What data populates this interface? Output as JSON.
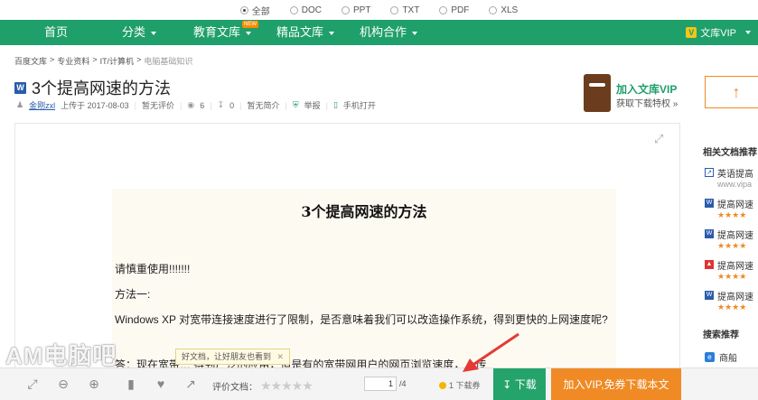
{
  "filters": [
    "全部",
    "DOC",
    "PPT",
    "TXT",
    "PDF",
    "XLS"
  ],
  "nav": {
    "items": [
      "首页",
      "分类",
      "教育文库",
      "精品文库",
      "机构合作"
    ],
    "new_badge": "NEW",
    "vip": "文库VIP"
  },
  "breadcrumb": [
    "百度文库",
    "专业资料",
    "IT/计算机",
    "电脑基础知识"
  ],
  "doc": {
    "type_icon": "W",
    "title": "3个提高网速的方法",
    "author": "金刚zxl",
    "uploaded": "上传于 2017-08-03",
    "rating": "暂无评价",
    "views": "6",
    "downloads": "0",
    "summary": "暂无简介",
    "report": "举报",
    "mobile": "手机打开"
  },
  "promo": {
    "title": "加入文库VIP",
    "subtitle": "获取下载特权 »"
  },
  "upload": {
    "label": "↑"
  },
  "page": {
    "title": "3个提高网速的方法",
    "lines": [
      "请慎重使用!!!!!!!",
      "方法一:",
      "Windows XP 对宽带连接速度进行了限制，是否意味着我们可以改造操作系统，得到更快的上网速度呢?",
      "答：现在宽带… 得到广泛的应用，但是有的宽带网用户的网页浏览速度，上传"
    ]
  },
  "toolbar": {
    "rating_label": "评价文档：",
    "stars": "★★★★★",
    "page_current": "1",
    "page_total": "/4",
    "ticket": "1 下载券",
    "download": "下载",
    "vip_download": "加入VIP,免券下载本文"
  },
  "tooltip": "好文档，让好朋友也看到",
  "sidebar": {
    "heading": "相关文档推荐",
    "items": [
      {
        "icon": "link",
        "title": "英语提高",
        "sub": "www.vipa"
      },
      {
        "icon": "W",
        "title": "提高网速",
        "sub": "★★★★"
      },
      {
        "icon": "W",
        "title": "提高网速",
        "sub": "★★★★"
      },
      {
        "icon": "pdf",
        "title": "提高网速",
        "sub": "★★★★"
      },
      {
        "icon": "W",
        "title": "提高网速",
        "sub": "★★★★"
      }
    ],
    "search_heading": "搜索推荐",
    "search_item": "商船"
  },
  "watermark": {
    "text": "AM电脑吧"
  },
  "colors": {
    "brand_green": "#1f9f6a",
    "accent_orange": "#f08a24"
  }
}
